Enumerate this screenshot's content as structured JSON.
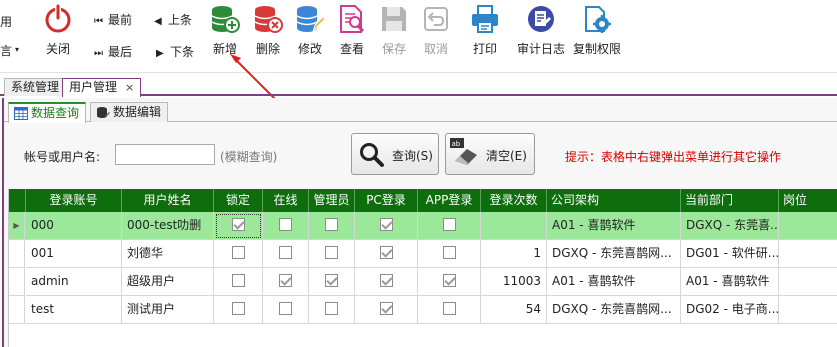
{
  "toolbar": {
    "cut_left_top": "用",
    "cut_left_bottom": "言",
    "close": "关闭",
    "first": "最前",
    "last": "最后",
    "prev": "上条",
    "next": "下条",
    "add": "新增",
    "delete": "删除",
    "edit": "修改",
    "view": "查看",
    "save": "保存",
    "cancel": "取消",
    "print": "打印",
    "audit_log": "审计日志",
    "copy_perm": "复制权限"
  },
  "tabs": {
    "system": "系统管理",
    "user": "用户管理",
    "close_glyph": "×"
  },
  "subtabs": {
    "query": "数据查询",
    "edit": "数据编辑"
  },
  "search": {
    "label": "帐号或用户名:",
    "value": "",
    "hint": "(模糊查询)",
    "query_button": "查询(S)",
    "clear_button": "清空(E)",
    "tip": "提示：表格中右键弹出菜单进行其它操作"
  },
  "grid": {
    "columns": [
      "登录账号",
      "用户姓名",
      "锁定",
      "在线",
      "管理员",
      "PC登录",
      "APP登录",
      "登录次数",
      "公司架构",
      "当前部门",
      "岗位"
    ],
    "rows": [
      {
        "account": "000",
        "name": "000-test叻删",
        "locked": true,
        "online": false,
        "admin": false,
        "pc": true,
        "app": false,
        "count": "",
        "company": "A01 - 喜鹊软件",
        "dept": "DGXQ - 东莞喜...",
        "post": ""
      },
      {
        "account": "001",
        "name": "刘德华",
        "locked": false,
        "online": false,
        "admin": false,
        "pc": true,
        "app": false,
        "count": "1",
        "company": "DGXQ - 东莞喜鹊网...",
        "dept": "DG01 - 软件研...",
        "post": ""
      },
      {
        "account": "admin",
        "name": "超级用户",
        "locked": false,
        "online": true,
        "admin": true,
        "pc": true,
        "app": true,
        "count": "11003",
        "company": "A01 - 喜鹊软件",
        "dept": "A01 - 喜鹊软件",
        "post": ""
      },
      {
        "account": "test",
        "name": "测试用户",
        "locked": false,
        "online": false,
        "admin": false,
        "pc": true,
        "app": false,
        "count": "54",
        "company": "DGXQ - 东莞喜鹊网...",
        "dept": "DG02 - 电子商...",
        "post": ""
      }
    ]
  },
  "colors": {
    "header_green": "#0e6e0e",
    "selected_row": "#9be89b",
    "tab_accent": "#7d3f7d",
    "tip_red": "#d40000",
    "arrow_red": "#e02020"
  }
}
